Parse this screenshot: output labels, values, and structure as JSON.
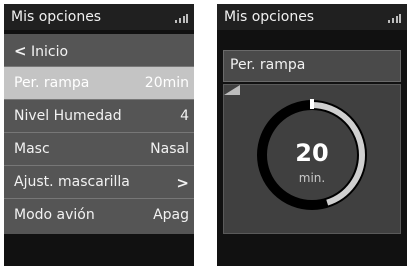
{
  "left_screen": {
    "title": "Mis opciones",
    "back_label": "Inicio",
    "back_icon": "chevron-left-icon",
    "rows": [
      {
        "label": "Per. rampa",
        "value": "20min",
        "selected": true
      },
      {
        "label": "Nivel Humedad",
        "value": "4",
        "selected": false
      },
      {
        "label": "Masc",
        "value": "Nasal",
        "selected": false
      },
      {
        "label": "Ajust. mascarilla",
        "value": ">",
        "selected": false
      },
      {
        "label": "Modo avión",
        "value": "Apag",
        "selected": false
      }
    ]
  },
  "right_screen": {
    "title": "Mis opciones",
    "setting_label": "Per. rampa",
    "dial_value": "20",
    "dial_unit": "min.",
    "dial_fraction": 0.45,
    "corner_icon": "ramp-icon"
  },
  "icons": {
    "signal": "signal-strength-icon"
  },
  "colors": {
    "screen_bg": "#111111",
    "menu_bg": "#555555",
    "selected_row_bg": "#c4c4c4",
    "dial_track": "#000000",
    "dial_progress": "#cfcfcf"
  }
}
